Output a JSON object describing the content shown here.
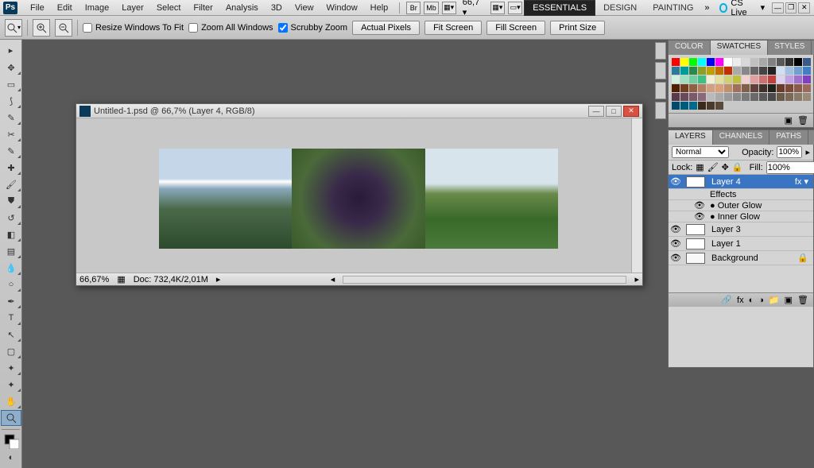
{
  "menubar": {
    "logo": "Ps",
    "items": [
      "File",
      "Edit",
      "Image",
      "Layer",
      "Select",
      "Filter",
      "Analysis",
      "3D",
      "View",
      "Window",
      "Help"
    ],
    "zoom_display": "66,7",
    "workspaces": [
      "ESSENTIALS",
      "DESIGN",
      "PAINTING"
    ],
    "cslive": "CS Live"
  },
  "optbar": {
    "resize_label": "Resize Windows To Fit",
    "zoom_all_label": "Zoom All Windows",
    "scrubby_label": "Scrubby Zoom",
    "btn_actual": "Actual Pixels",
    "btn_fit": "Fit Screen",
    "btn_fill": "Fill Screen",
    "btn_print": "Print Size"
  },
  "doc": {
    "title": "Untitled-1.psd @ 66,7% (Layer 4, RGB/8)",
    "zoom": "66,67%",
    "info": "Doc: 732,4K/2,01M"
  },
  "panels": {
    "color_tabs": [
      "COLOR",
      "SWATCHES",
      "STYLES"
    ],
    "layers_tabs": [
      "LAYERS",
      "CHANNELS",
      "PATHS"
    ],
    "blend_mode": "Normal",
    "opacity_label": "Opacity:",
    "opacity_val": "100%",
    "lock_label": "Lock:",
    "fill_label": "Fill:",
    "fill_val": "100%",
    "layers": [
      {
        "name": "Layer 4",
        "sel": true,
        "fx": true
      },
      {
        "name": "Effects",
        "sub": true
      },
      {
        "name": "Outer Glow",
        "sub": true,
        "bullet": true
      },
      {
        "name": "Inner Glow",
        "sub": true,
        "bullet": true
      },
      {
        "name": "Layer 3"
      },
      {
        "name": "Layer 1"
      },
      {
        "name": "Background",
        "locked": true
      }
    ]
  },
  "swatches_colors": [
    "#ff0000",
    "#ffff00",
    "#00ff00",
    "#00ffff",
    "#0000ff",
    "#ff00ff",
    "#ffffff",
    "#ececec",
    "#d8d8d8",
    "#c0c0c0",
    "#a8a8a8",
    "#808080",
    "#585858",
    "#303030",
    "#000000",
    "#3a5a8a",
    "#2a7a9a",
    "#009a9a",
    "#2a8a4a",
    "#8aa02a",
    "#c0a000",
    "#c07000",
    "#c03000",
    "#aaaaaa",
    "#888888",
    "#666666",
    "#444444",
    "#222222",
    "#d0e0f0",
    "#a0c0e0",
    "#70a0d0",
    "#4080c0",
    "#d0f0e0",
    "#a0e0c0",
    "#70d0a0",
    "#40c080",
    "#f0f0d0",
    "#e0e0a0",
    "#d0d070",
    "#c0c040",
    "#f0d0d0",
    "#e0a0a0",
    "#d07070",
    "#c04040",
    "#e0d0f0",
    "#c0a0e0",
    "#a070d0",
    "#8040c0",
    "#502000",
    "#704020",
    "#906040",
    "#b08060",
    "#d0a080",
    "#daa07a",
    "#c0906a",
    "#a0705a",
    "#80604a",
    "#60403a",
    "#40302a",
    "#20201a",
    "#6a3a2a",
    "#7a4a3a",
    "#8a5a4a",
    "#9a6a5a",
    "#5a3a4a",
    "#6a4a5a",
    "#7a5a6a",
    "#8a6a7a",
    "#bababa",
    "#aaaaaa",
    "#9a9a9a",
    "#8a8a8a",
    "#7a7a7a",
    "#6a6a6a",
    "#5a5a5a",
    "#4a4a4a",
    "#6a5a4a",
    "#7a6a5a",
    "#8a7a6a",
    "#9a8a7a",
    "#004a6a",
    "#005a7a",
    "#006a8a",
    "#3a2a1a",
    "#4a3a2a",
    "#5a4a3a"
  ]
}
